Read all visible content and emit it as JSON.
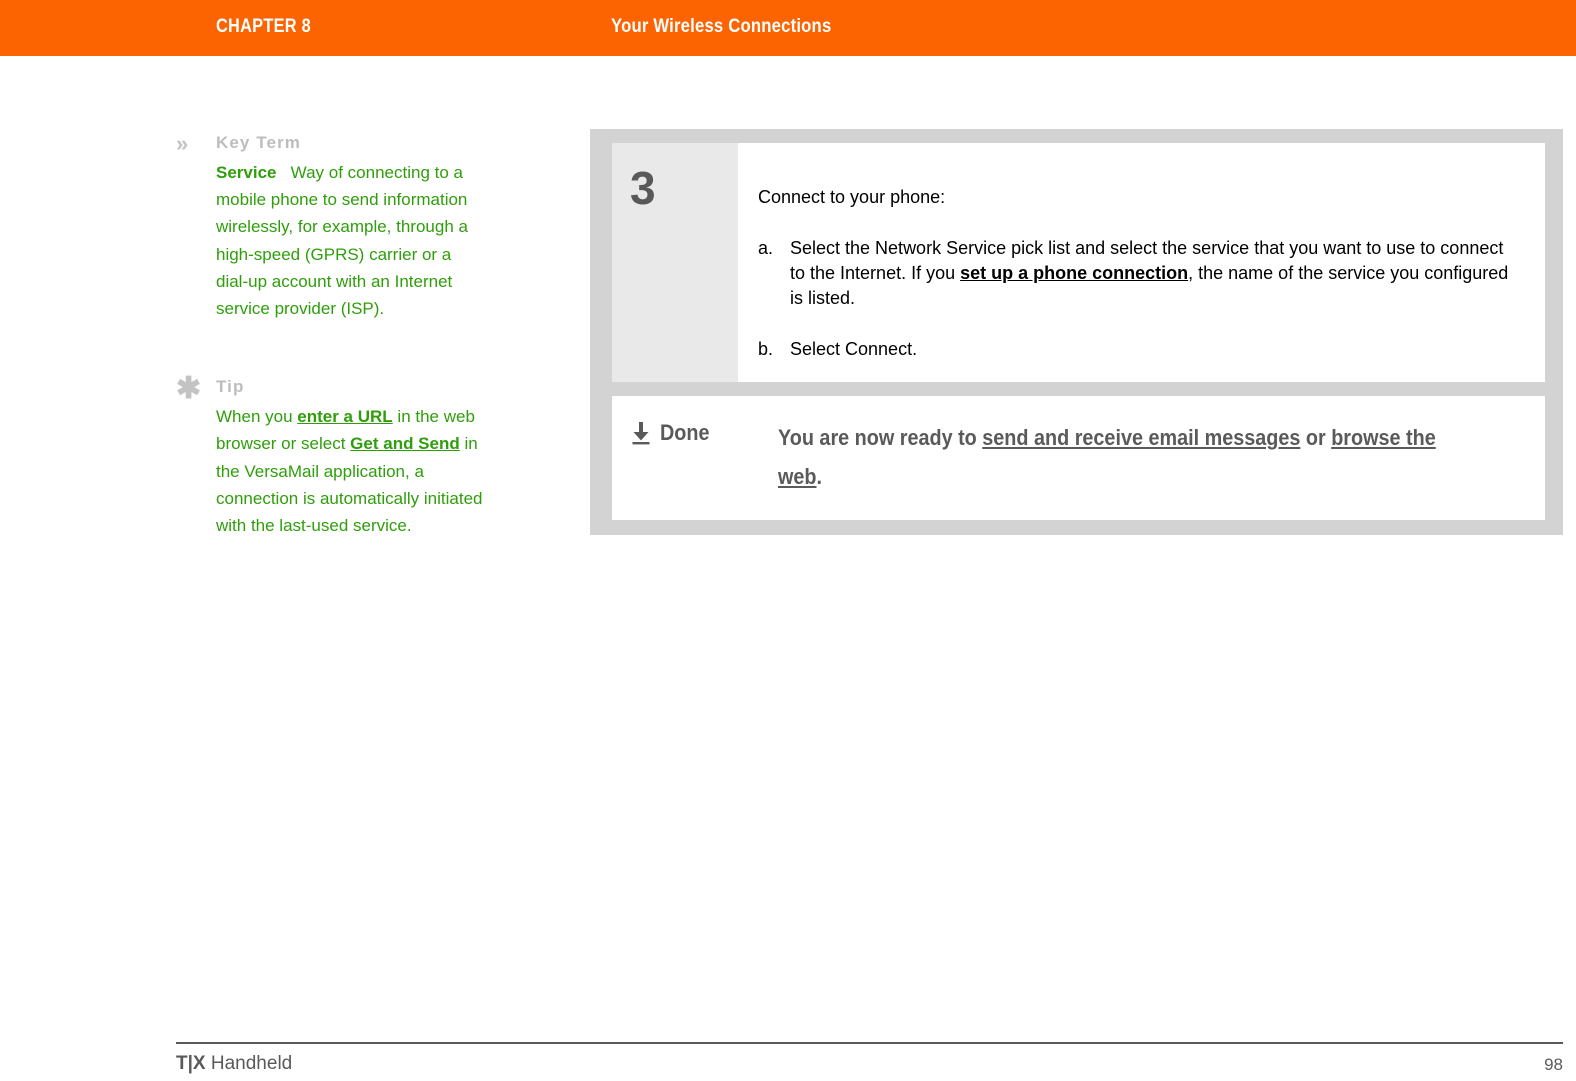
{
  "header": {
    "chapter_label": "CHAPTER 8",
    "chapter_title": "Your Wireless Connections",
    "background_color": "#fb6400",
    "text_color": "#ffffff"
  },
  "sidebar": {
    "notes": [
      {
        "icon": "double-chevron-icon",
        "icon_glyph": "»",
        "heading": "Key Term",
        "term": "Service",
        "body": "Way of connecting to a mobile phone to send information wirelessly, for example, through a high-speed (GPRS) carrier or a dial-up account with an Internet service provider (ISP)."
      },
      {
        "icon": "asterisk-icon",
        "icon_glyph": "✳",
        "heading": "Tip",
        "body_part_1": "When you ",
        "link_1": "enter a URL",
        "body_part_2": " in the web browser or select ",
        "link_2": "Get and Send",
        "body_part_3": " in the VersaMail application, a connection is automatically initiated with the last-used service."
      }
    ],
    "text_color": "#2f9e0b",
    "heading_color": "#bdbdbd"
  },
  "procedure": {
    "step": {
      "number": "3",
      "lead": "Connect to your phone:",
      "substeps": [
        {
          "marker": "a.",
          "text_part_1": "Select the Network Service pick list and select the service that you want to use to connect to the Internet. If you ",
          "link": "set up a phone connection",
          "text_part_2": ", the name of the service you configured is listed."
        },
        {
          "marker": "b.",
          "text_part_1": "Select Connect.",
          "link": "",
          "text_part_2": ""
        }
      ]
    },
    "done": {
      "icon": "down-arrow-to-line-icon",
      "label": "Done",
      "text_part_1": "You are now ready to ",
      "link_1": "send and receive email messages",
      "text_part_2": " or ",
      "link_2": "browse the web",
      "text_part_3": "."
    },
    "panel_color": "#d3d3d3",
    "card_color": "#ffffff",
    "number_col_color": "#e9e9e9"
  },
  "footer": {
    "product_mark": "T|X",
    "product_name": " Handheld",
    "page_number": "98",
    "rule_color": "#5a5a5a"
  }
}
